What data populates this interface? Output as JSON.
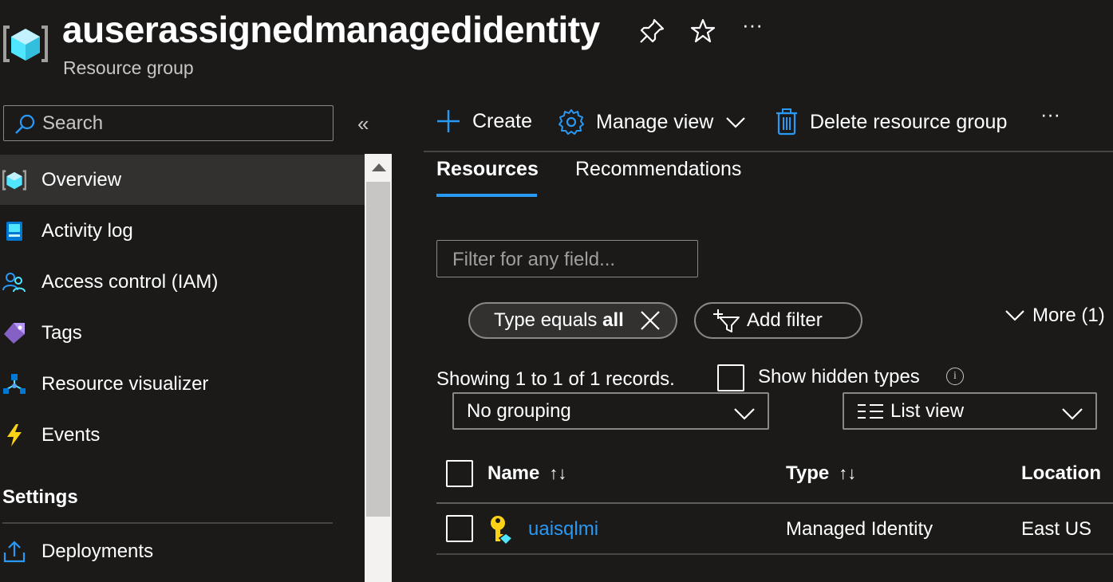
{
  "header": {
    "title": "auserassignedmanagedidentity",
    "subtitle": "Resource group",
    "more_label": "···"
  },
  "sidebar": {
    "search_placeholder": "Search",
    "collapse_label": "«",
    "items": [
      {
        "label": "Overview",
        "icon": "resource-group-icon",
        "active": true
      },
      {
        "label": "Activity log",
        "icon": "activity-log-icon"
      },
      {
        "label": "Access control (IAM)",
        "icon": "people-icon"
      },
      {
        "label": "Tags",
        "icon": "tag-icon"
      },
      {
        "label": "Resource visualizer",
        "icon": "visualizer-icon"
      },
      {
        "label": "Events",
        "icon": "lightning-icon"
      }
    ],
    "section_title": "Settings",
    "section_items": [
      {
        "label": "Deployments",
        "icon": "upload-icon"
      }
    ]
  },
  "toolbar": {
    "create_label": "Create",
    "manage_view_label": "Manage view",
    "delete_label": "Delete resource group",
    "more_label": "···"
  },
  "tabs": [
    {
      "label": "Resources",
      "active": true
    },
    {
      "label": "Recommendations"
    }
  ],
  "filter": {
    "placeholder": "Filter for any field...",
    "type_pill_prefix": "Type equals ",
    "type_pill_value": "all",
    "add_filter_label": "Add filter",
    "more_label": "More (1)"
  },
  "records": {
    "showing_text": "Showing 1 to 1 of 1 records.",
    "show_hidden_label": "Show hidden types"
  },
  "grouping": {
    "selected": "No grouping"
  },
  "view": {
    "selected": "List view"
  },
  "table": {
    "columns": [
      "Name",
      "Type",
      "Location"
    ],
    "rows": [
      {
        "name": "uaisqlmi",
        "type": "Managed Identity",
        "location": "East US"
      }
    ]
  },
  "colors": {
    "background": "#1b1a19",
    "accent": "#2899f5",
    "active_nav": "#323130"
  }
}
